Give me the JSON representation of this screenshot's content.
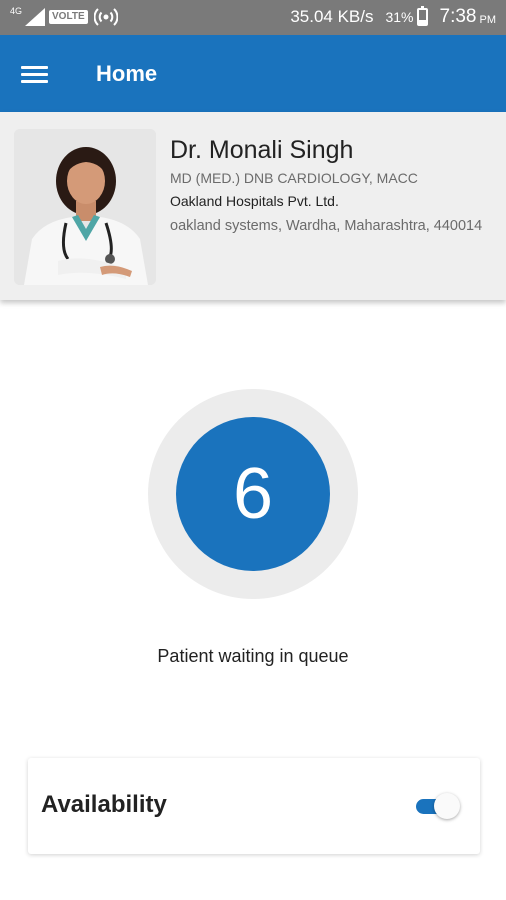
{
  "status_bar": {
    "network_type": "4G",
    "volte": "VOLTE",
    "speed": "35.04 KB/s",
    "battery_percent": "31%",
    "battery_level": 0.31,
    "time": "7:38",
    "ampm": "PM",
    "icons": [
      "signal-icon",
      "hotspot-icon",
      "battery-icon"
    ]
  },
  "app_bar": {
    "title": "Home",
    "menu_icon": "hamburger-menu-icon",
    "color": "#1a73bd"
  },
  "profile": {
    "name": "Dr. Monali Singh",
    "qualification": "MD (MED.) DNB CARDIOLOGY, MACC",
    "hospital": "Oakland Hospitals Pvt. Ltd.",
    "address": "oakland systems, Wardha, Maharashtra, 440014"
  },
  "queue": {
    "count": "6",
    "caption": "Patient waiting in queue"
  },
  "availability": {
    "label": "Availability",
    "enabled": true
  }
}
